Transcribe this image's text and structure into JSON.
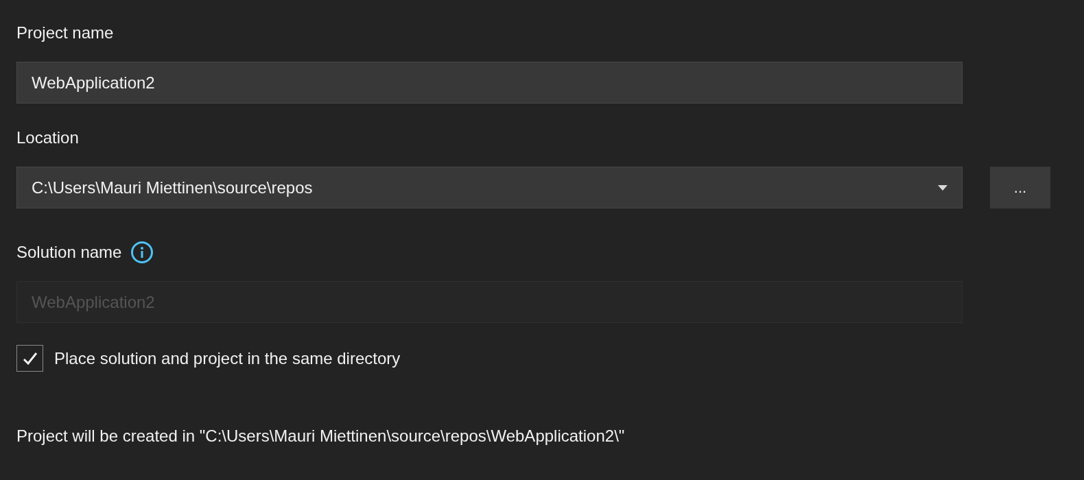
{
  "fields": [
    {
      "label": "Project name",
      "kind": "text",
      "value": "WebApplication2",
      "disabled": false,
      "info": false
    },
    {
      "label": "Location",
      "kind": "dropdown",
      "value": "C:\\Users\\Mauri Miettinen\\source\\repos",
      "disabled": false,
      "info": false,
      "browse_button": "..."
    },
    {
      "label": "Solution name",
      "kind": "text",
      "value": "WebApplication2",
      "disabled": true,
      "info": true
    }
  ],
  "checkbox": {
    "label": "Place solution and project in the same directory",
    "checked": true
  },
  "footer": "Project will be created in \"C:\\Users\\Mauri Miettinen\\source\\repos\\WebApplication2\\\""
}
